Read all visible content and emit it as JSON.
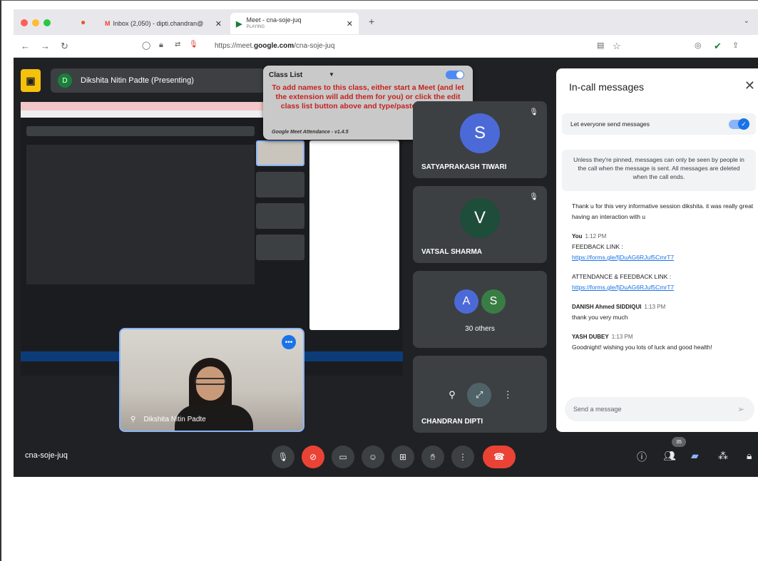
{
  "browser": {
    "tabs": [
      {
        "label": "Inbox (2,050) - dipti.chandran@",
        "icon": "gmail-icon"
      },
      {
        "label": "Meet - cna-soje-juq",
        "sub": "PLAYING",
        "icon": "meet-icon"
      }
    ],
    "url_prefix": "https://meet.",
    "url_domain": "google.com",
    "url_path": "/cna-soje-juq"
  },
  "presenter": {
    "initial": "D",
    "label": "Dikshita Nitin Padte (Presenting)"
  },
  "class_list": {
    "title": "Class List",
    "message": "To add names to this class, either start a Meet (and let the extension will add them for you) or click the edit class list button above and type/paste the names",
    "footer": "Google Meet Attendance - v1.4.5"
  },
  "participants": [
    {
      "initial": "S",
      "name": "SATYAPRAKASH TIWARI",
      "color": "#4c6ad7"
    },
    {
      "initial": "V",
      "name": "VATSAL SHARMA",
      "color": "#1e4d3a"
    },
    {
      "others_label": "30 others",
      "initials": [
        "A",
        "S"
      ],
      "colors": [
        "#4c6ad7",
        "#3a7d44"
      ]
    },
    {
      "name": "CHANDRAN DIPTI"
    }
  ],
  "self_video": {
    "label": "Dikshita Nitin Padte"
  },
  "chat": {
    "title": "In-call messages",
    "toggle_label": "Let everyone send messages",
    "notice": "Unless they're pinned, messages can only be seen by people in the call when the message is sent. All messages are deleted when the call ends.",
    "first_message": "Thank u for this very informative session dikshita. it was really great having an interaction with u",
    "messages": [
      {
        "sender": "You",
        "time": "1:12 PM",
        "lines": [
          "FEEDBACK LINK :"
        ],
        "link": "https://forms.gle/fjDuAG6RJuf5CmrT7"
      },
      {
        "lines": [
          "ATTENDANCE & FEEDBACK LINK :"
        ],
        "link": "https://forms.gle/fjDuAG6RJuf5CmrT7"
      },
      {
        "sender": "DANISH Ahmed SIDDIQUI",
        "time": "1:13 PM",
        "lines": [
          "thank you very much"
        ]
      },
      {
        "sender": "YASH DUBEY",
        "time": "1:13 PM",
        "lines": [
          "Goodnight! wishing you lots of luck and good health!"
        ]
      }
    ],
    "send_placeholder": "Send a message"
  },
  "meeting_code": "cna-soje-juq",
  "participant_count": "35"
}
